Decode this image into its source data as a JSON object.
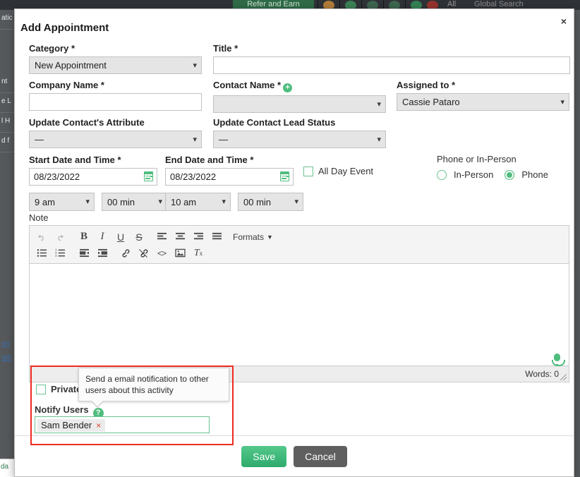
{
  "background": {
    "topbar": {
      "refer_label": "Refer and Earn",
      "scope_label": "All",
      "search_label": "Global Search",
      "icons": [
        "megaphone-icon",
        "add-icon",
        "link-icon",
        "clock-icon",
        "bell-icon",
        "avatar-icon"
      ]
    },
    "left_rows": [
      "atic",
      "nt",
      "e L",
      "l H",
      "d f",
      "",
      "rm",
      "oth"
    ],
    "bottom_label": "da"
  },
  "modal": {
    "title": "Add Appointment",
    "close_label": "×",
    "fields": {
      "category_label": "Category *",
      "category_value": "New Appointment",
      "title_label": "Title *",
      "title_value": "",
      "company_label": "Company Name *",
      "company_value": "",
      "contact_label": "Contact Name *",
      "contact_value": "",
      "assigned_label": "Assigned to *",
      "assigned_value": "Cassie Pataro",
      "attribute_label": "Update Contact's Attribute",
      "attribute_value": "—",
      "lead_status_label": "Update Contact Lead Status",
      "lead_status_value": "—",
      "start_label": "Start Date and Time *",
      "start_date": "08/23/2022",
      "start_hour": "9 am",
      "start_min": "00 min",
      "end_label": "End Date and Time *",
      "end_date": "08/23/2022",
      "end_hour": "10 am",
      "end_min": "00 min",
      "all_day_label": "All Day Event",
      "meeting_type_label": "Phone or In-Person",
      "in_person_label": "In-Person",
      "phone_label": "Phone",
      "note_label": "Note"
    },
    "editor": {
      "toolbar_row1": [
        {
          "name": "undo-icon",
          "glyph": "↶"
        },
        {
          "name": "redo-icon",
          "glyph": "↷"
        },
        {
          "name": "bold-icon",
          "glyph": "B"
        },
        {
          "name": "italic-icon",
          "glyph": "I"
        },
        {
          "name": "underline-icon",
          "glyph": "U"
        },
        {
          "name": "strikethrough-icon",
          "glyph": "S"
        },
        {
          "name": "align-left-icon",
          "glyph": ""
        },
        {
          "name": "align-center-icon",
          "glyph": ""
        },
        {
          "name": "align-right-icon",
          "glyph": ""
        },
        {
          "name": "align-justify-icon",
          "glyph": ""
        }
      ],
      "formats_label": "Formats",
      "toolbar_row2": [
        {
          "name": "bullet-list-icon",
          "glyph": ""
        },
        {
          "name": "numbered-list-icon",
          "glyph": ""
        },
        {
          "name": "outdent-icon",
          "glyph": ""
        },
        {
          "name": "indent-icon",
          "glyph": ""
        },
        {
          "name": "link-icon",
          "glyph": ""
        },
        {
          "name": "unlink-icon",
          "glyph": ""
        },
        {
          "name": "source-code-icon",
          "glyph": "<>"
        },
        {
          "name": "insert-image-icon",
          "glyph": ""
        },
        {
          "name": "clear-formatting-icon",
          "glyph": ""
        }
      ],
      "content": "",
      "words_label": "Words: 0"
    },
    "bottom": {
      "private_label": "Private",
      "notify_label": "Notify Users",
      "help_glyph": "?",
      "notify_chip": "Sam Bender",
      "chip_remove": "×",
      "tooltip_text": "Send a email notification to other users about this activity"
    },
    "footer": {
      "save_label": "Save",
      "cancel_label": "Cancel"
    }
  },
  "colors": {
    "accent_green": "#4fbd7e",
    "highlight_red": "#f02a20",
    "cancel_gray": "#5f5f5f"
  }
}
